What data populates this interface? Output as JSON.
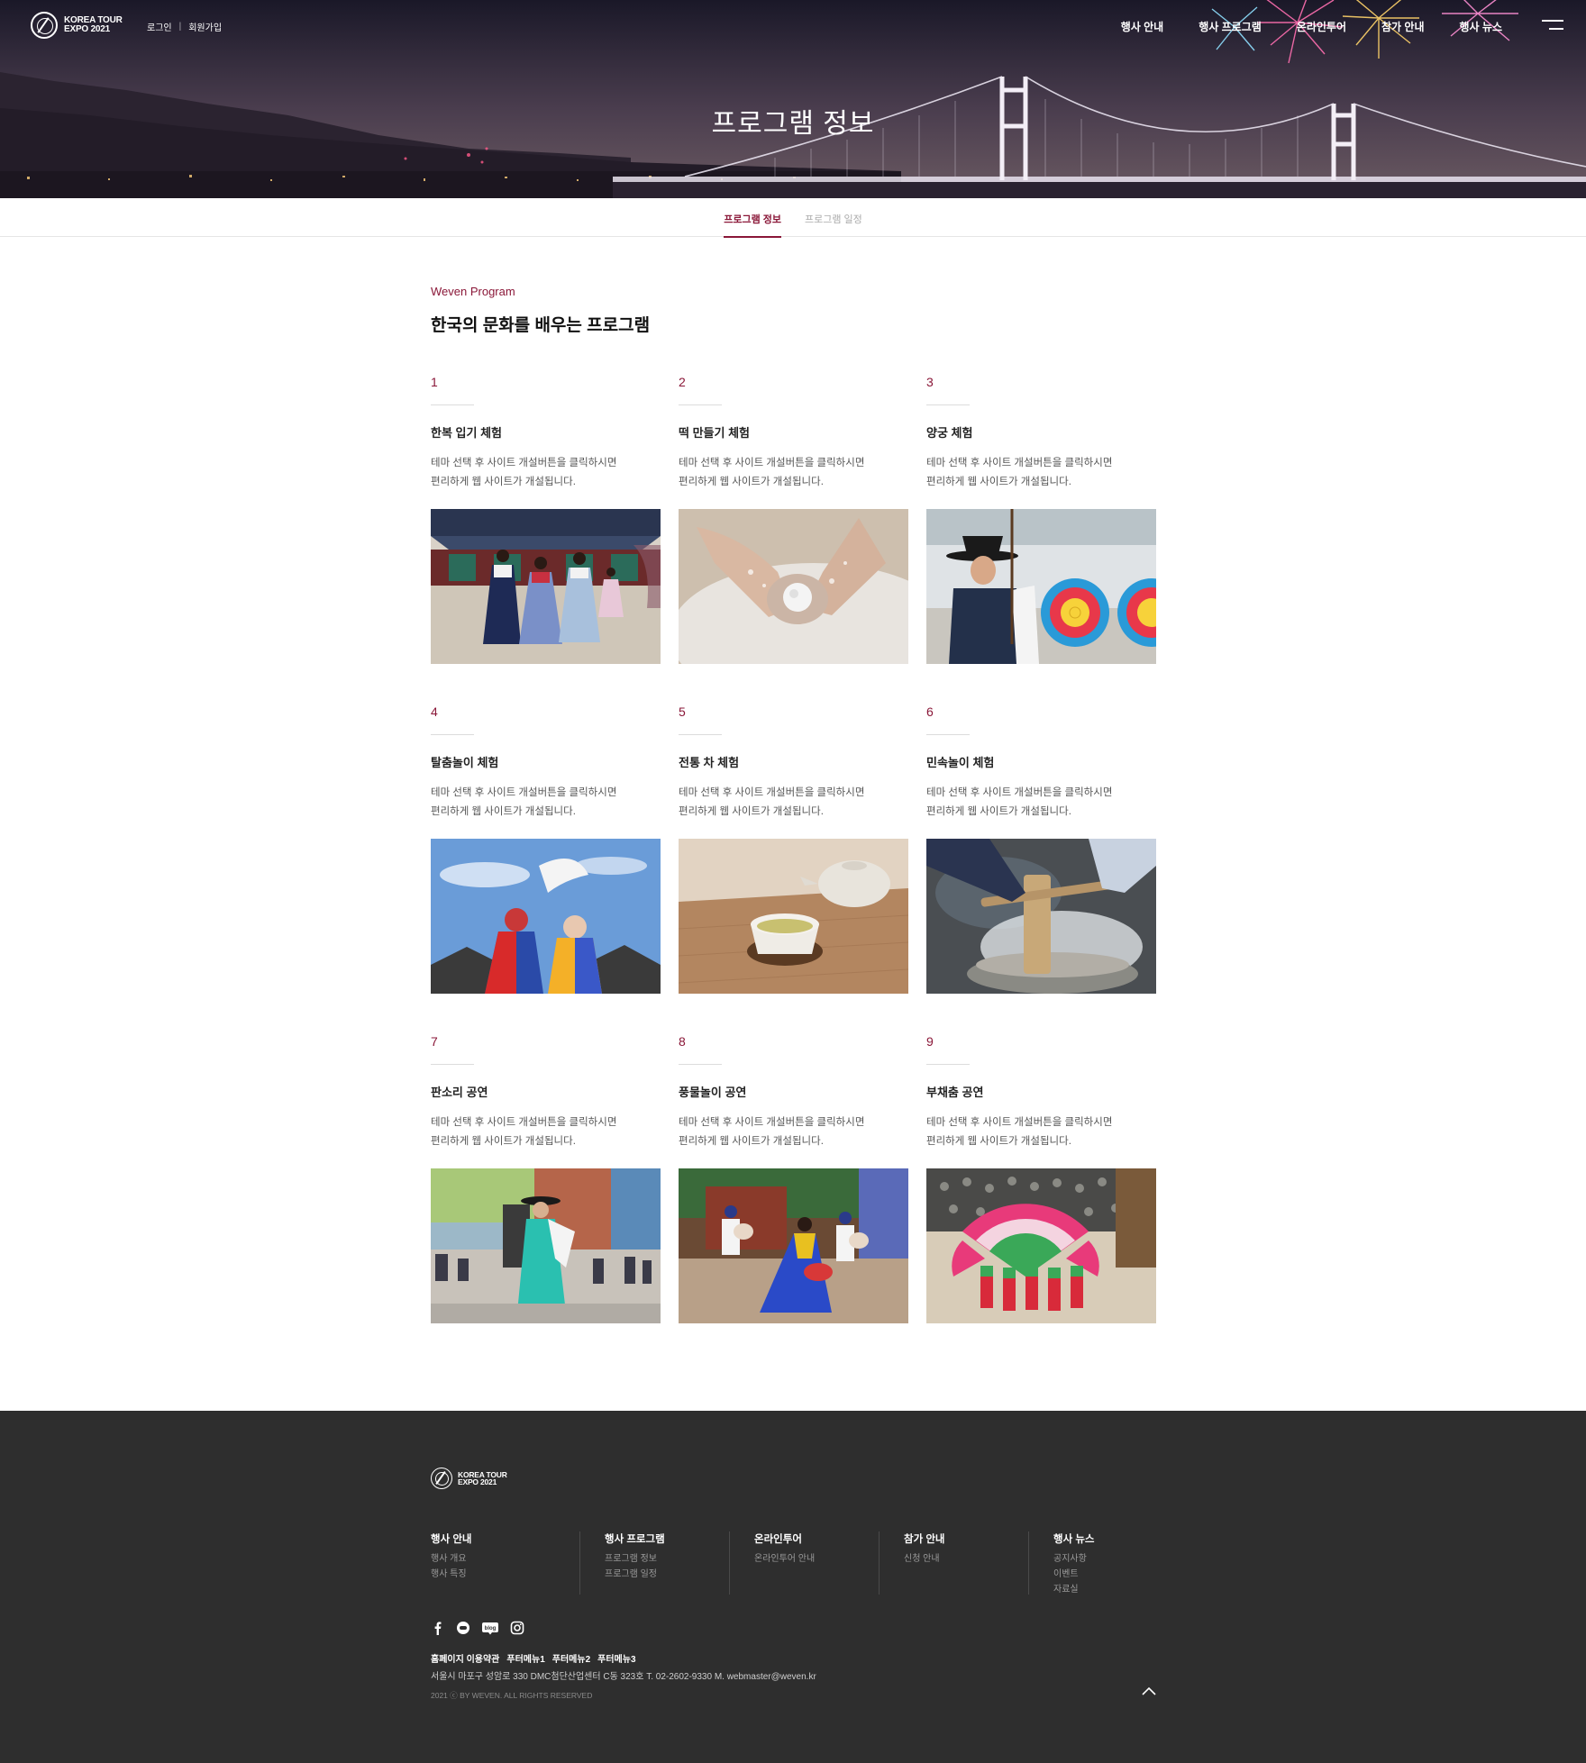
{
  "header": {
    "logo_line1": "KOREA TOUR",
    "logo_line2": "EXPO 2021",
    "login": "로그인",
    "divider": "|",
    "signup": "회원가입",
    "nav": [
      "행사 안내",
      "행사 프로그램",
      "온라인투어",
      "참가 안내",
      "행사 뉴스"
    ],
    "menu_icon": "hamburger-icon"
  },
  "hero": {
    "title": "프로그램 정보"
  },
  "tabs": [
    {
      "label": "프로그램 정보",
      "active": true
    },
    {
      "label": "프로그램 일정",
      "active": false
    }
  ],
  "section": {
    "eyebrow": "Weven Program",
    "title": "한국의 문화를 배우는 프로그램"
  },
  "programs": [
    {
      "num": "1",
      "title": "한복 입기 체험",
      "desc1": "테마 선택 후 사이트 개설버튼을 클릭하시면",
      "desc2": "편리하게 웹 사이트가 개설됩니다."
    },
    {
      "num": "2",
      "title": "떡 만들기 체험",
      "desc1": "테마 선택 후 사이트 개설버튼을 클릭하시면",
      "desc2": "편리하게 웹 사이트가 개설됩니다."
    },
    {
      "num": "3",
      "title": "양궁 체험",
      "desc1": "테마 선택 후 사이트 개설버튼을 클릭하시면",
      "desc2": "편리하게 웹 사이트가 개설됩니다."
    },
    {
      "num": "4",
      "title": "탈춤놀이 체험",
      "desc1": "테마 선택 후 사이트 개설버튼을 클릭하시면",
      "desc2": "편리하게 웹 사이트가 개설됩니다."
    },
    {
      "num": "5",
      "title": "전통 차 체험",
      "desc1": "테마 선택 후 사이트 개설버튼을 클릭하시면",
      "desc2": "편리하게 웹 사이트가 개설됩니다."
    },
    {
      "num": "6",
      "title": "민속놀이 체험",
      "desc1": "테마 선택 후 사이트 개설버튼을 클릭하시면",
      "desc2": "편리하게 웹 사이트가 개설됩니다."
    },
    {
      "num": "7",
      "title": "판소리 공연",
      "desc1": "테마 선택 후 사이트 개설버튼을 클릭하시면",
      "desc2": "편리하게 웹 사이트가 개설됩니다."
    },
    {
      "num": "8",
      "title": "풍물놀이 공연",
      "desc1": "테마 선택 후 사이트 개설버튼을 클릭하시면",
      "desc2": "편리하게 웹 사이트가 개설됩니다."
    },
    {
      "num": "9",
      "title": "부채춤 공연",
      "desc1": "테마 선택 후 사이트 개설버튼을 클릭하시면",
      "desc2": "편리하게 웹 사이트가 개설됩니다."
    }
  ],
  "footer": {
    "logo_line1": "KOREA TOUR",
    "logo_line2": "EXPO 2021",
    "columns": [
      {
        "title": "행사 안내",
        "links": [
          "행사 개요",
          "행사 특징"
        ]
      },
      {
        "title": "행사 프로그램",
        "links": [
          "프로그램 정보",
          "프로그램 일정"
        ]
      },
      {
        "title": "온라인투어",
        "links": [
          "온라인투어 안내"
        ]
      },
      {
        "title": "참가 안내",
        "links": [
          "신청 안내"
        ]
      },
      {
        "title": "행사 뉴스",
        "links": [
          "공지사항",
          "이벤트",
          "자료실"
        ]
      }
    ],
    "social_icons": [
      "facebook-icon",
      "talk-icon",
      "blog-icon",
      "instagram-icon"
    ],
    "blog_label": "blog",
    "links": [
      "홈페이지 이용약관",
      "푸터메뉴1",
      "푸터메뉴2",
      "푸터메뉴3"
    ],
    "address": "서울시 마포구 성암로 330 DMC첨단산업센터 C동 323호   T. 02-2602-9330 M. webmaster@weven.kr",
    "copyright": "2021 ⓒ BY WEVEN. ALL RIGHTS RESERVED",
    "top_icon": "chevron-up-icon"
  },
  "colors": {
    "accent": "#8a1738",
    "footer_bg": "#2e2e2e",
    "text": "#222222"
  }
}
